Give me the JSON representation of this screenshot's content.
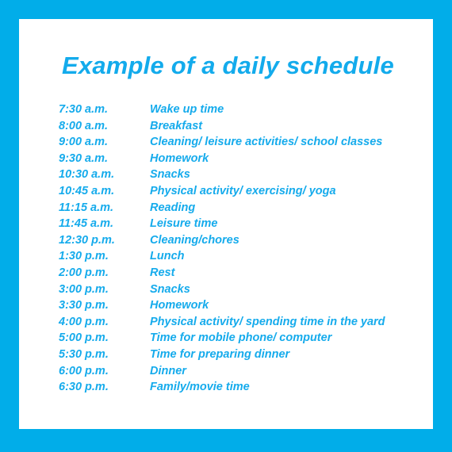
{
  "document": {
    "title": "Example of a daily schedule",
    "colors": {
      "border": "#01ADE9",
      "card_background": "#FFFFFF",
      "text_accent": "#15ABEC"
    }
  },
  "schedule": {
    "rows": [
      {
        "time": "7:30 a.m.",
        "activity": "Wake up time"
      },
      {
        "time": "8:00 a.m.",
        "activity": "Breakfast"
      },
      {
        "time": "9:00 a.m.",
        "activity": "Cleaning/ leisure activities/ school classes"
      },
      {
        "time": "9:30 a.m.",
        "activity": "Homework"
      },
      {
        "time": "10:30 a.m.",
        "activity": "Snacks"
      },
      {
        "time": "10:45 a.m.",
        "activity": "Physical activity/ exercising/ yoga"
      },
      {
        "time": "11:15 a.m.",
        "activity": "Reading"
      },
      {
        "time": "11:45 a.m.",
        "activity": "Leisure time"
      },
      {
        "time": "12:30 p.m.",
        "activity": "Cleaning/chores"
      },
      {
        "time": "1:30 p.m.",
        "activity": "Lunch"
      },
      {
        "time": "2:00 p.m.",
        "activity": "Rest"
      },
      {
        "time": "3:00 p.m.",
        "activity": "Snacks"
      },
      {
        "time": "3:30 p.m.",
        "activity": "Homework"
      },
      {
        "time": "4:00 p.m.",
        "activity": "Physical activity/ spending time in the yard"
      },
      {
        "time": "5:00 p.m.",
        "activity": "Time for mobile phone/ computer"
      },
      {
        "time": "5:30 p.m.",
        "activity": "Time for preparing dinner"
      },
      {
        "time": "6:00 p.m.",
        "activity": "Dinner"
      },
      {
        "time": "6:30 p.m.",
        "activity": "Family/movie time"
      }
    ]
  }
}
